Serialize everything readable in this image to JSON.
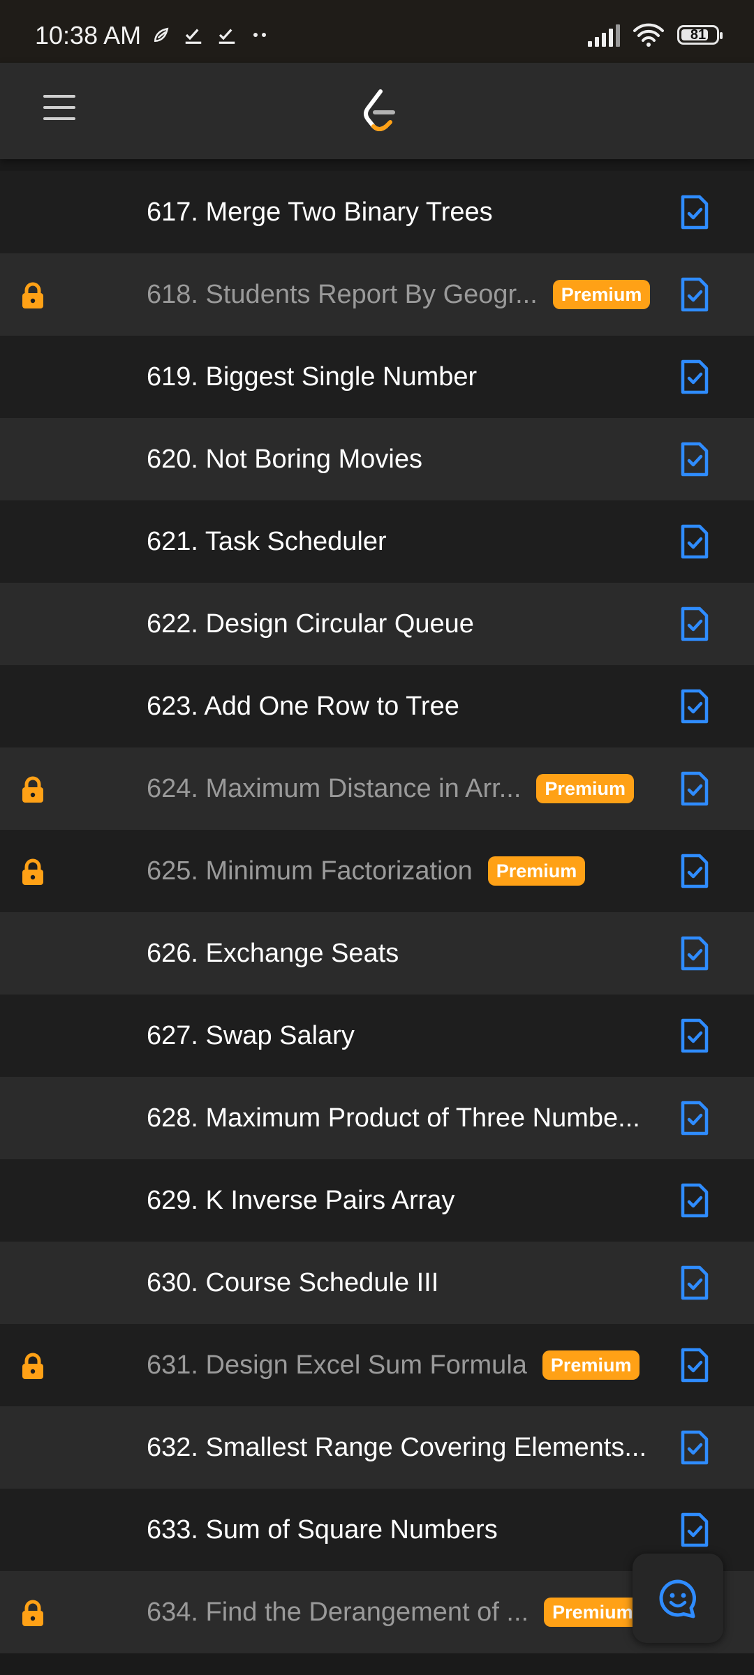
{
  "status_bar": {
    "time": "10:38 AM",
    "battery": "81"
  },
  "colors": {
    "accent": "#ffa116",
    "solution_icon": "#2f8cff",
    "row_dark": "#1e1e1e",
    "row_light": "#2b2b2b"
  },
  "problems": [
    {
      "title": "617. Merge Two Binary Trees",
      "premium": false
    },
    {
      "title": "618. Students Report By Geogr...",
      "premium": true
    },
    {
      "title": "619. Biggest Single Number",
      "premium": false
    },
    {
      "title": "620. Not Boring Movies",
      "premium": false
    },
    {
      "title": "621. Task Scheduler",
      "premium": false
    },
    {
      "title": "622. Design Circular Queue",
      "premium": false
    },
    {
      "title": "623. Add One Row to Tree",
      "premium": false
    },
    {
      "title": "624. Maximum Distance in Arr...",
      "premium": true
    },
    {
      "title": "625. Minimum Factorization",
      "premium": true
    },
    {
      "title": "626. Exchange Seats",
      "premium": false
    },
    {
      "title": "627. Swap Salary",
      "premium": false
    },
    {
      "title": "628. Maximum Product of Three Numbe...",
      "premium": false
    },
    {
      "title": "629. K Inverse Pairs Array",
      "premium": false
    },
    {
      "title": "630. Course Schedule III",
      "premium": false
    },
    {
      "title": "631. Design Excel Sum Formula",
      "premium": true
    },
    {
      "title": "632. Smallest Range Covering Elements...",
      "premium": false
    },
    {
      "title": "633. Sum of Square Numbers",
      "premium": false
    },
    {
      "title": "634. Find the Derangement of ...",
      "premium": true
    }
  ],
  "badge_label": "Premium"
}
